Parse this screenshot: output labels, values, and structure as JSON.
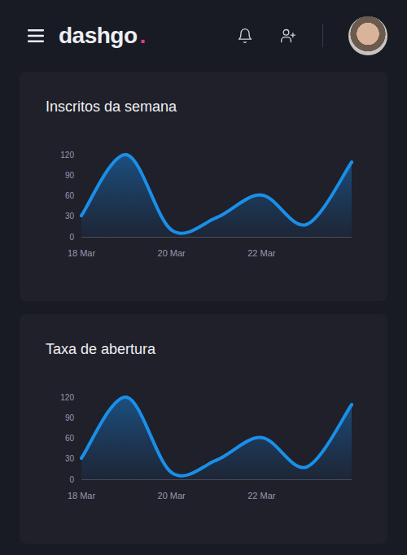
{
  "header": {
    "logo": {
      "text": "dashgo",
      "dot": "."
    }
  },
  "charts": [
    {
      "title": "Inscritos da semana",
      "y_ticks": [
        "120",
        "90",
        "60",
        "30",
        "0"
      ],
      "x_labels": [
        {
          "text": "18 Mar",
          "index": 0
        },
        {
          "text": "20 Mar",
          "index": 2
        },
        {
          "text": "22 Mar",
          "index": 4
        }
      ],
      "series": [
        {
          "values": [
            31,
            120,
            10,
            28,
            61,
            18,
            109
          ]
        }
      ]
    },
    {
      "title": "Taxa de abertura",
      "y_ticks": [
        "120",
        "90",
        "60",
        "30",
        "0"
      ],
      "x_labels": [
        {
          "text": "18 Mar",
          "index": 0
        },
        {
          "text": "20 Mar",
          "index": 2
        },
        {
          "text": "22 Mar",
          "index": 4
        }
      ],
      "series": [
        {
          "values": [
            31,
            120,
            10,
            28,
            61,
            18,
            109
          ]
        }
      ]
    }
  ]
}
